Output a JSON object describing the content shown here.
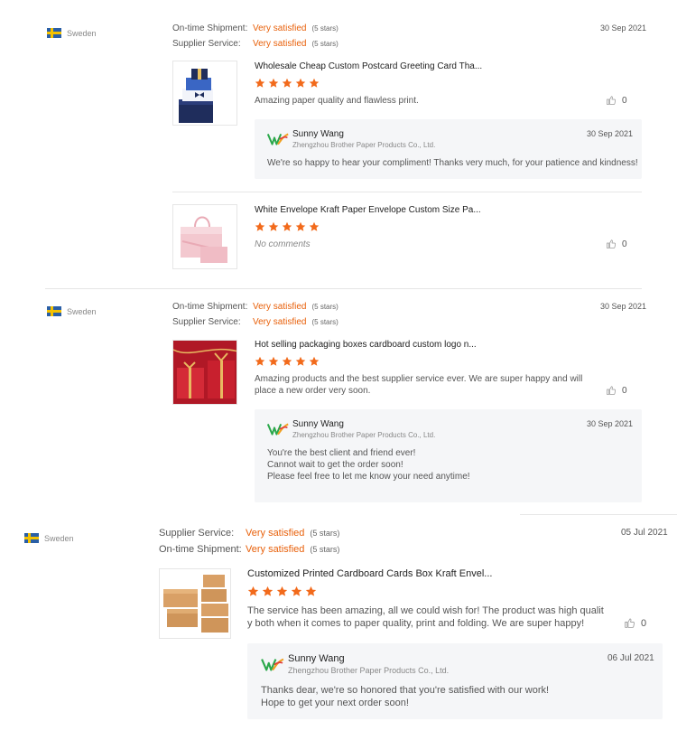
{
  "labels": {
    "ontime": "On-time Shipment:",
    "supplier": "Supplier Service:",
    "very_satisfied": "Very satisfied",
    "five_stars": "(5 stars)"
  },
  "reviews": [
    {
      "country": "Sweden",
      "date": "30 Sep 2021",
      "products": [
        {
          "title": "Wholesale Cheap Custom Postcard Greeting Card Tha...",
          "comment": "Amazing paper quality and flawless print.",
          "likes": "0",
          "reply": {
            "name": "Sunny Wang",
            "company": "Zhengzhou Brother Paper Products Co., Ltd.",
            "date": "30 Sep 2021",
            "message": "We're so happy to hear your compliment! Thanks very much, for your patience and kindness!"
          }
        },
        {
          "title": "White Envelope Kraft Paper Envelope Custom Size Pa...",
          "comment": "No comments",
          "likes": "0"
        }
      ]
    },
    {
      "country": "Sweden",
      "date": "30 Sep 2021",
      "products": [
        {
          "title": "Hot selling packaging boxes cardboard custom logo n...",
          "comment_line1": "Amazing products and the best supplier service ever. We are super happy and will",
          "comment_line2": "place a new order very soon.",
          "likes": "0",
          "reply": {
            "name": "Sunny Wang",
            "company": "Zhengzhou Brother Paper Products Co., Ltd.",
            "date": "30 Sep 2021",
            "line1": "You're the best client and friend ever!",
            "line2": "Cannot wait to get the order soon!",
            "line3": "Please feel free to let me know your need anytime!"
          }
        }
      ]
    },
    {
      "country": "Sweden",
      "date": "05 Jul 2021",
      "products": [
        {
          "title": "Customized Printed Cardboard Cards Box Kraft Envel...",
          "comment_line1": "The service has been amazing, all we could wish for! The product was high qualit",
          "comment_line2": "y both when it comes to paper quality, print and folding. We are super happy!",
          "likes": "0",
          "reply": {
            "name": "Sunny Wang",
            "company": "Zhengzhou Brother Paper Products Co., Ltd.",
            "date": "06 Jul 2021",
            "line1": "Thanks dear, we're so honored that you're satisfied with our work!",
            "line2": "Hope to get your next order soon!"
          }
        }
      ]
    }
  ],
  "colors": {
    "accent": "#e8600a",
    "star": "#f26a1b",
    "reply_bg": "#f5f6f8"
  }
}
